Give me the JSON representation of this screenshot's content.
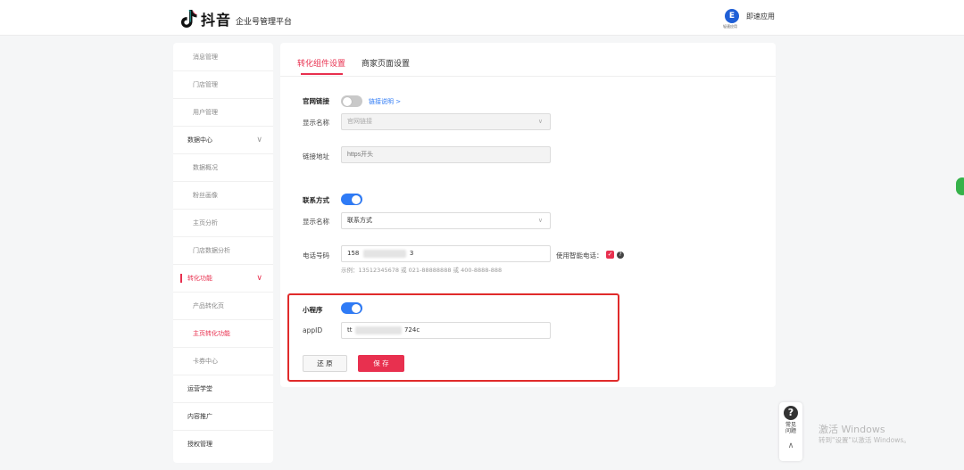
{
  "header": {
    "logo_text": "抖音",
    "platform_name": "企业号管理平台",
    "apply_icon_caption": "轻速应用",
    "apply_label": "即速应用"
  },
  "sidebar": {
    "items": [
      {
        "label": "消息管理"
      },
      {
        "label": "门店管理"
      },
      {
        "label": "用户管理"
      },
      {
        "label": "数据中心"
      },
      {
        "label": "数据概况"
      },
      {
        "label": "粉丝画像"
      },
      {
        "label": "主页分析"
      },
      {
        "label": "门店数据分析"
      },
      {
        "label": "转化功能"
      },
      {
        "label": "产品转化页"
      },
      {
        "label": "主页转化功能"
      },
      {
        "label": "卡券中心"
      },
      {
        "label": "运营学堂"
      },
      {
        "label": "内容推广"
      },
      {
        "label": "授权管理"
      }
    ],
    "expand_glyph": "∨"
  },
  "tabs": [
    {
      "label": "转化组件设置"
    },
    {
      "label": "商家页面设置"
    }
  ],
  "website": {
    "title": "官网链接",
    "enabled": false,
    "help_link": "链接说明 >",
    "display_name_label": "显示名称",
    "display_name_value": "官网链接",
    "url_label": "链接地址",
    "url_placeholder": "https开头"
  },
  "contact": {
    "title": "联系方式",
    "enabled": true,
    "display_name_label": "显示名称",
    "display_name_value": "联系方式",
    "phone_label": "电话号码",
    "phone_prefix": "158",
    "phone_suffix": "3",
    "smart_phone_label": "使用智能电话：",
    "checked": true,
    "example": "示例：13512345678 或 021-88888888 或 400-8888-888"
  },
  "miniprogram": {
    "title": "小程序",
    "enabled": true,
    "appid_label": "appID",
    "appid_prefix": "tt",
    "appid_suffix": "724c",
    "reset_label": "还 原",
    "save_label": "保 存"
  },
  "help_widget": {
    "icon_glyph": "?",
    "line1": "常见",
    "line2": "问题",
    "up_glyph": "∧"
  },
  "watermark": {
    "line1": "激活 Windows",
    "line2": "转到\"设置\"以激活 Windows。"
  },
  "colors": {
    "accent": "#e8304f",
    "toggle_on": "#2f7bf6",
    "highlight_border": "#e02b2b"
  }
}
